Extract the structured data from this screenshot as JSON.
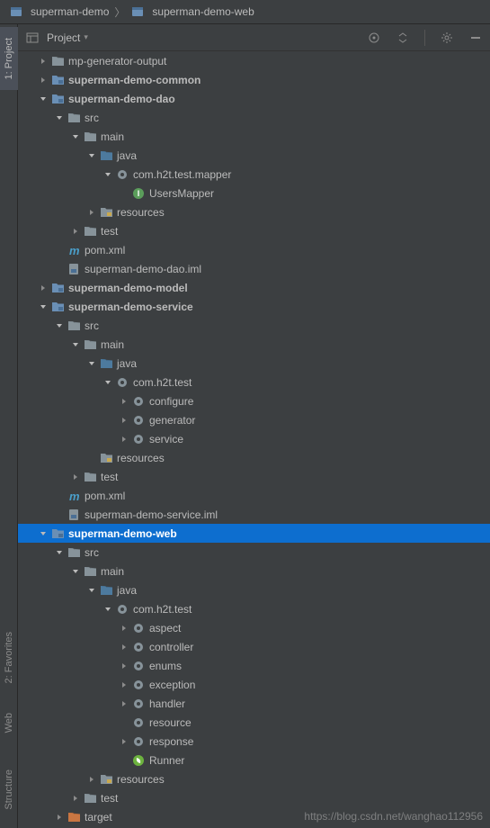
{
  "breadcrumbs": [
    {
      "label": "superman-demo",
      "icon": "module"
    },
    {
      "label": "superman-demo-web",
      "icon": "module"
    }
  ],
  "toolbar": {
    "project_label": "Project",
    "dropdown": "▾"
  },
  "side_tabs": {
    "project": "1: Project",
    "favorites": "2: Favorites",
    "web": "Web",
    "structure": "Structure"
  },
  "watermark": "https://blog.csdn.net/wanghao112956",
  "tree": [
    {
      "d": 1,
      "arrow": "right",
      "icon": "folder",
      "label": "mp-generator-output"
    },
    {
      "d": 1,
      "arrow": "right",
      "icon": "module",
      "label": "superman-demo-common",
      "bold": true
    },
    {
      "d": 1,
      "arrow": "down",
      "icon": "module",
      "label": "superman-demo-dao",
      "bold": true
    },
    {
      "d": 2,
      "arrow": "down",
      "icon": "folder",
      "label": "src"
    },
    {
      "d": 3,
      "arrow": "down",
      "icon": "folder",
      "label": "main"
    },
    {
      "d": 4,
      "arrow": "down",
      "icon": "src-folder",
      "label": "java"
    },
    {
      "d": 5,
      "arrow": "down",
      "icon": "package",
      "label": "com.h2t.test.mapper"
    },
    {
      "d": 6,
      "arrow": "none",
      "icon": "interface",
      "label": "UsersMapper"
    },
    {
      "d": 4,
      "arrow": "right",
      "icon": "res-folder",
      "label": "resources"
    },
    {
      "d": 3,
      "arrow": "right",
      "icon": "folder",
      "label": "test"
    },
    {
      "d": 2,
      "arrow": "none",
      "icon": "maven",
      "label": "pom.xml"
    },
    {
      "d": 2,
      "arrow": "none",
      "icon": "iml",
      "label": "superman-demo-dao.iml"
    },
    {
      "d": 1,
      "arrow": "right",
      "icon": "module",
      "label": "superman-demo-model",
      "bold": true
    },
    {
      "d": 1,
      "arrow": "down",
      "icon": "module",
      "label": "superman-demo-service",
      "bold": true
    },
    {
      "d": 2,
      "arrow": "down",
      "icon": "folder",
      "label": "src"
    },
    {
      "d": 3,
      "arrow": "down",
      "icon": "folder",
      "label": "main"
    },
    {
      "d": 4,
      "arrow": "down",
      "icon": "src-folder",
      "label": "java"
    },
    {
      "d": 5,
      "arrow": "down",
      "icon": "package",
      "label": "com.h2t.test"
    },
    {
      "d": 6,
      "arrow": "right",
      "icon": "package",
      "label": "configure"
    },
    {
      "d": 6,
      "arrow": "right",
      "icon": "package",
      "label": "generator"
    },
    {
      "d": 6,
      "arrow": "right",
      "icon": "package",
      "label": "service"
    },
    {
      "d": 4,
      "arrow": "none",
      "icon": "res-folder",
      "label": "resources"
    },
    {
      "d": 3,
      "arrow": "right",
      "icon": "folder",
      "label": "test"
    },
    {
      "d": 2,
      "arrow": "none",
      "icon": "maven",
      "label": "pom.xml"
    },
    {
      "d": 2,
      "arrow": "none",
      "icon": "iml",
      "label": "superman-demo-service.iml"
    },
    {
      "d": 1,
      "arrow": "down",
      "icon": "module",
      "label": "superman-demo-web",
      "bold": true,
      "selected": true
    },
    {
      "d": 2,
      "arrow": "down",
      "icon": "folder",
      "label": "src"
    },
    {
      "d": 3,
      "arrow": "down",
      "icon": "folder",
      "label": "main"
    },
    {
      "d": 4,
      "arrow": "down",
      "icon": "src-folder",
      "label": "java"
    },
    {
      "d": 5,
      "arrow": "down",
      "icon": "package",
      "label": "com.h2t.test"
    },
    {
      "d": 6,
      "arrow": "right",
      "icon": "package",
      "label": "aspect"
    },
    {
      "d": 6,
      "arrow": "right",
      "icon": "package",
      "label": "controller"
    },
    {
      "d": 6,
      "arrow": "right",
      "icon": "package",
      "label": "enums"
    },
    {
      "d": 6,
      "arrow": "right",
      "icon": "package",
      "label": "exception"
    },
    {
      "d": 6,
      "arrow": "right",
      "icon": "package",
      "label": "handler"
    },
    {
      "d": 6,
      "arrow": "none",
      "icon": "package",
      "label": "resource"
    },
    {
      "d": 6,
      "arrow": "right",
      "icon": "package",
      "label": "response"
    },
    {
      "d": 6,
      "arrow": "none",
      "icon": "spring",
      "label": "Runner"
    },
    {
      "d": 4,
      "arrow": "right",
      "icon": "res-folder",
      "label": "resources"
    },
    {
      "d": 3,
      "arrow": "right",
      "icon": "folder",
      "label": "test"
    },
    {
      "d": 2,
      "arrow": "right",
      "icon": "build-folder",
      "label": "target"
    }
  ]
}
